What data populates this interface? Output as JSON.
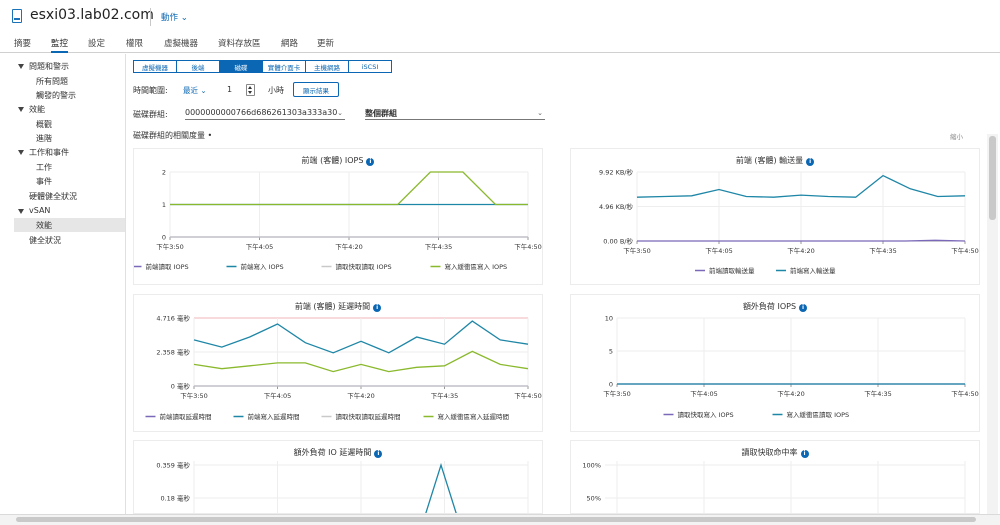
{
  "header": {
    "host": "esxi03.lab02.com",
    "actions": "動作 ⌄",
    "host_icon": "host-server-icon"
  },
  "tabs": [
    {
      "label": "摘要",
      "active": false
    },
    {
      "label": "監控",
      "active": true
    },
    {
      "label": "設定",
      "active": false
    },
    {
      "label": "權限",
      "active": false
    },
    {
      "label": "虛擬機器",
      "active": false
    },
    {
      "label": "資料存放區",
      "active": false
    },
    {
      "label": "網路",
      "active": false
    },
    {
      "label": "更新",
      "active": false
    }
  ],
  "nav": {
    "issues": "問題和警示",
    "all_issues": "所有問題",
    "triggered_alarms": "觸發的警示",
    "performance": "效能",
    "overview": "概觀",
    "advanced": "進階",
    "tasks_events": "工作和事件",
    "tasks": "工作",
    "events": "事件",
    "hardware_health": "硬體健全狀況",
    "vsan": "vSAN",
    "vsan_performance": "效能",
    "health": "健全狀況"
  },
  "segments": [
    {
      "label": "虛擬機器",
      "active": false
    },
    {
      "label": "後端",
      "active": false
    },
    {
      "label": "磁碟",
      "active": true
    },
    {
      "label": "實體介面卡",
      "active": false
    },
    {
      "label": "主機網路",
      "active": false
    },
    {
      "label": "iSCSI",
      "active": false
    }
  ],
  "time_range": {
    "label": "時間範圍:",
    "mode": "最近 ⌄",
    "value": "1",
    "unit": "小時",
    "show_button": "顯示結果"
  },
  "disk_group": {
    "label": "磁碟群組:",
    "value": "0000000000766d686261303a333a30",
    "chev": "⌄",
    "mode": "整個群組",
    "mode_chev": "⌄"
  },
  "section": {
    "title": "磁碟群組的相關度量 •",
    "collapse": "縮小"
  },
  "times": [
    "下午3:50",
    "下午4:05",
    "下午4:20",
    "下午4:35",
    "下午4:50"
  ],
  "colors": {
    "purple": "#7b68b8",
    "teal": "#1e86a6",
    "lightgray": "#c9c9c9",
    "green": "#8ab92d",
    "pink": "#e8a8b0",
    "accent": "#0b67b3"
  },
  "charts": {
    "iops": {
      "title": "前端 (客體) IOPS",
      "yticks": [
        "2",
        "1",
        "0"
      ],
      "legend": [
        "前端讀取 IOPS",
        "前端寫入 IOPS",
        "讀取快取讀取 IOPS",
        "寫入緩衝區寫入 IOPS"
      ]
    },
    "throughput": {
      "title": "前端 (客體) 輸送量",
      "yticks": [
        "9.92 KB/秒",
        "4.96 KB/秒",
        "0.00 B/秒"
      ],
      "legend": [
        "前端讀取輸送量",
        "前端寫入輸送量"
      ]
    },
    "latency": {
      "title": "前端 (客體) 延遲時間",
      "yticks": [
        "4.716 毫秒",
        "2.358 毫秒",
        "0 毫秒"
      ],
      "legend": [
        "前端讀取延遲時間",
        "前端寫入延遲時間",
        "讀取快取讀取延遲時間",
        "寫入緩衝區寫入延遲時間"
      ]
    },
    "overhead_iops": {
      "title": "額外負荷 IOPS",
      "yticks": [
        "10",
        "5",
        "0"
      ],
      "legend": [
        "讀取快取寫入 IOPS",
        "寫入緩衝區讀取 IOPS"
      ]
    },
    "overhead_latency": {
      "title": "額外負荷 IO 延遲時間",
      "yticks": [
        "0.359 毫秒",
        "0.18 毫秒"
      ]
    },
    "hit_rate": {
      "title": "讀取快取命中率",
      "yticks": [
        "100%",
        "50%"
      ]
    }
  },
  "chart_data": [
    {
      "type": "line",
      "title": "前端 (客體) IOPS",
      "x": [
        "下午3:50",
        "下午4:05",
        "下午4:20",
        "下午4:35",
        "下午4:50"
      ],
      "ylim": [
        0,
        2
      ],
      "series": [
        {
          "name": "前端讀取 IOPS",
          "color": "#7b68b8",
          "values": [
            0,
            0,
            0,
            0,
            0,
            0,
            0,
            0,
            0,
            0,
            0,
            0
          ]
        },
        {
          "name": "前端寫入 IOPS",
          "color": "#1e86a6",
          "values": [
            1,
            1,
            1,
            1,
            1,
            1,
            1,
            1,
            1,
            1,
            1,
            1
          ]
        },
        {
          "name": "讀取快取讀取 IOPS",
          "color": "#c9c9c9",
          "values": [
            0,
            0,
            0,
            0,
            0,
            0,
            0,
            0,
            0,
            0,
            0,
            0
          ]
        },
        {
          "name": "寫入緩衝區寫入 IOPS",
          "color": "#8ab92d",
          "values": [
            1,
            1,
            1,
            1,
            1,
            1,
            1,
            1,
            2,
            2,
            1,
            1
          ]
        }
      ]
    },
    {
      "type": "line",
      "title": "前端 (客體) 輸送量",
      "x": [
        "下午3:50",
        "下午4:05",
        "下午4:20",
        "下午4:35",
        "下午4:50"
      ],
      "ylim": [
        0,
        9.92
      ],
      "yunit": "KB/秒",
      "series": [
        {
          "name": "前端讀取輸送量",
          "color": "#7b68b8",
          "values": [
            0,
            0,
            0,
            0,
            0,
            0,
            0,
            0,
            0,
            0,
            0.1,
            0
          ]
        },
        {
          "name": "前端寫入輸送量",
          "color": "#1e86a6",
          "values": [
            6.3,
            6.4,
            6.5,
            7.4,
            6.4,
            6.3,
            6.6,
            6.4,
            6.3,
            9.4,
            7.5,
            6.4,
            6.5
          ]
        }
      ]
    },
    {
      "type": "line",
      "title": "前端 (客體) 延遲時間",
      "x": [
        "下午3:50",
        "下午4:05",
        "下午4:20",
        "下午4:35",
        "下午4:50"
      ],
      "ylim": [
        0,
        4.716
      ],
      "yunit": "毫秒",
      "series": [
        {
          "name": "前端讀取延遲時間",
          "color": "#7b68b8",
          "values": [
            0,
            0,
            0,
            0,
            0,
            0,
            0,
            0,
            0,
            0,
            0,
            0
          ]
        },
        {
          "name": "前端寫入延遲時間",
          "color": "#1e86a6",
          "values": [
            3.2,
            2.7,
            3.4,
            4.3,
            3.0,
            2.3,
            3.1,
            2.3,
            3.4,
            2.9,
            4.5,
            3.2,
            2.9
          ]
        },
        {
          "name": "讀取快取讀取延遲時間",
          "color": "#c9c9c9",
          "values": [
            0,
            0,
            0,
            0,
            0,
            0,
            0,
            0,
            0,
            0,
            0,
            0
          ]
        },
        {
          "name": "寫入緩衝區寫入延遲時間",
          "color": "#8ab92d",
          "values": [
            1.5,
            1.2,
            1.4,
            1.6,
            1.6,
            1.0,
            1.5,
            1.0,
            1.3,
            1.4,
            2.4,
            1.5,
            1.2
          ]
        }
      ]
    },
    {
      "type": "line",
      "title": "額外負荷 IOPS",
      "x": [
        "下午3:50",
        "下午4:05",
        "下午4:20",
        "下午4:35",
        "下午4:50"
      ],
      "ylim": [
        0,
        10
      ],
      "series": [
        {
          "name": "讀取快取寫入 IOPS",
          "color": "#7b68b8",
          "values": [
            0,
            0,
            0,
            0,
            0,
            0,
            0,
            0,
            0,
            0,
            0,
            0
          ]
        },
        {
          "name": "寫入緩衝區讀取 IOPS",
          "color": "#1e86a6",
          "values": [
            0,
            0,
            0,
            0,
            0,
            0,
            0,
            0,
            0,
            0,
            0,
            0
          ]
        }
      ]
    },
    {
      "type": "line",
      "title": "額外負荷 IO 延遲時間",
      "yticks": [
        "0.359 毫秒",
        "0.18 毫秒"
      ],
      "series": [
        {
          "color": "#1e86a6",
          "values": [
            0.05,
            0.359,
            0.05
          ]
        }
      ]
    },
    {
      "type": "line",
      "title": "讀取快取命中率",
      "yticks": [
        "100%",
        "50%"
      ],
      "series": []
    }
  ]
}
